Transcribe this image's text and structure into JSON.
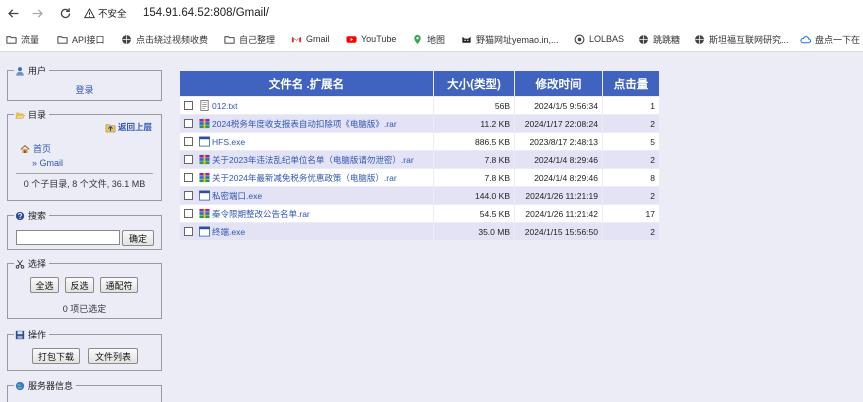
{
  "browser": {
    "security_label": "不安全",
    "url": "154.91.64.52:808/Gmail/",
    "bookmarks": [
      {
        "label": "流量",
        "icon": "folder-icon"
      },
      {
        "label": "API接口",
        "icon": "folder-icon"
      },
      {
        "label": "点击绕过视频收费",
        "icon": "globe-icon"
      },
      {
        "label": "自己整理",
        "icon": "folder-icon"
      },
      {
        "label": "Gmail",
        "icon": "gmail-icon"
      },
      {
        "label": "YouTube",
        "icon": "youtube-icon"
      },
      {
        "label": "地图",
        "icon": "maps-icon"
      },
      {
        "label": "野猫网址yemao.in,...",
        "icon": "cat-icon"
      },
      {
        "label": "LOLBAS",
        "icon": "globe-icon"
      },
      {
        "label": "跳跳糖",
        "icon": "globe-icon"
      },
      {
        "label": "斯坦福互联网研究...",
        "icon": "globe-icon"
      },
      {
        "label": "盘点一下在",
        "icon": "cloud-icon"
      }
    ]
  },
  "sidebar": {
    "user": {
      "title": "用户",
      "login_link": "登录"
    },
    "dir": {
      "title": "目录",
      "up_link": "返回上层",
      "home_link": "首页",
      "current_link": "» Gmail",
      "summary": "0 个子目录, 8 个文件, 36.1 MB"
    },
    "search": {
      "title": "搜索",
      "button": "确定",
      "input_value": ""
    },
    "select": {
      "title": "选择",
      "buttons": [
        "全选",
        "反选",
        "通配符"
      ],
      "status": "0 项已选定"
    },
    "actions": {
      "title": "操作",
      "buttons": [
        "打包下载",
        "文件列表"
      ]
    },
    "server": {
      "title": "服务器信息"
    }
  },
  "table": {
    "headers": [
      "文件名 .扩展名",
      "大小(类型)",
      "修改时间",
      "点击量"
    ],
    "rows": [
      {
        "name": "012.txt",
        "type": "txt",
        "size": "56B",
        "date": "2024/1/5 9:56:34",
        "clicks": "1"
      },
      {
        "name": "2024税务年度收支报表自动扣除项《电脑版》.rar",
        "type": "rar",
        "size": "11.2 KB",
        "date": "2024/1/17 22:08:24",
        "clicks": "2"
      },
      {
        "name": "HFS.exe",
        "type": "exe",
        "size": "886.5 KB",
        "date": "2023/8/17 2:48:13",
        "clicks": "5"
      },
      {
        "name": "关于2023年违法乱纪单位名单（电脑版请勿泄密）.rar",
        "type": "rar",
        "size": "7.8 KB",
        "date": "2024/1/4 8:29:46",
        "clicks": "2"
      },
      {
        "name": "关于2024年最新减免税务优惠政策（电脑版）.rar",
        "type": "rar",
        "size": "7.8 KB",
        "date": "2024/1/4 8:29:46",
        "clicks": "8"
      },
      {
        "name": "私密端口.exe",
        "type": "exe",
        "size": "144.0 KB",
        "date": "2024/1/26 11:21:19",
        "clicks": "2"
      },
      {
        "name": "秦令限期整改公告名单.rar",
        "type": "rar",
        "size": "54.5 KB",
        "date": "2024/1/26 11:21:42",
        "clicks": "17"
      },
      {
        "name": "终端.exe",
        "type": "exe",
        "size": "35.0 MB",
        "date": "2024/1/15 15:56:50",
        "clicks": "2"
      }
    ]
  }
}
